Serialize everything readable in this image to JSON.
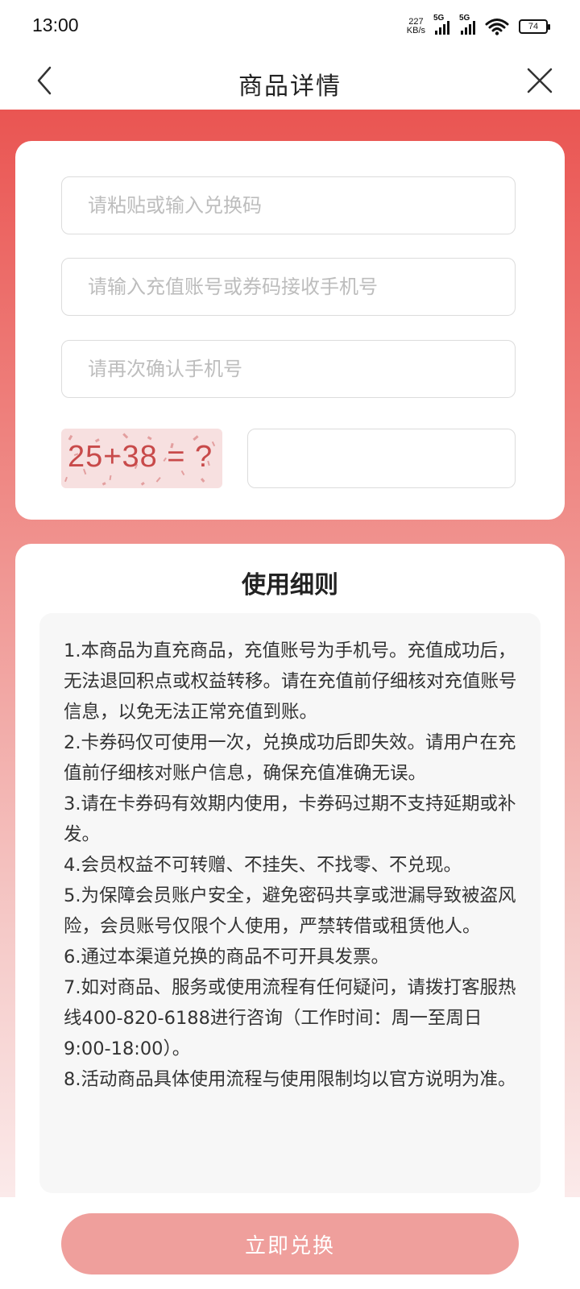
{
  "status_bar": {
    "time": "13:00",
    "net_speed_value": "227",
    "net_speed_unit": "KB/s",
    "signal1_label": "5G",
    "signal2_label": "5G",
    "battery": "74"
  },
  "nav": {
    "title": "商品详情",
    "back_icon": "chevron-left-icon",
    "close_icon": "close-icon"
  },
  "form": {
    "redeem_code_placeholder": "请粘贴或输入兑换码",
    "account_placeholder": "请输入充值账号或券码接收手机号",
    "confirm_phone_placeholder": "请再次确认手机号",
    "captcha_text": "25+38 = ?",
    "captcha_answer_value": ""
  },
  "rules": {
    "title": "使用细则",
    "items": [
      "1.本商品为直充商品，充值账号为手机号。充值成功后，无法退回积点或权益转移。请在充值前仔细核对充值账号信息，以免无法正常充值到账。",
      "2.卡券码仅可使用一次，兑换成功后即失效。请用户在充值前仔细核对账户信息，确保充值准确无误。",
      "3.请在卡券码有效期内使用，卡券码过期不支持延期或补发。",
      "4.会员权益不可转赠、不挂失、不找零、不兑现。",
      "5.为保障会员账户安全，避免密码共享或泄漏导致被盗风险，会员账号仅限个人使用，严禁转借或租赁他人。",
      "6.通过本渠道兑换的商品不可开具发票。",
      "7.如对商品、服务或使用流程有任何疑问，请拨打客服热线400-820-6188进行咨询（工作时间：周一至周日9:00-18:00）。",
      "8.活动商品具体使用流程与使用限制均以官方说明为准。"
    ]
  },
  "submit": {
    "label": "立即兑换"
  },
  "colors": {
    "accent": "#ea5552",
    "button": "#ef9f9c"
  }
}
